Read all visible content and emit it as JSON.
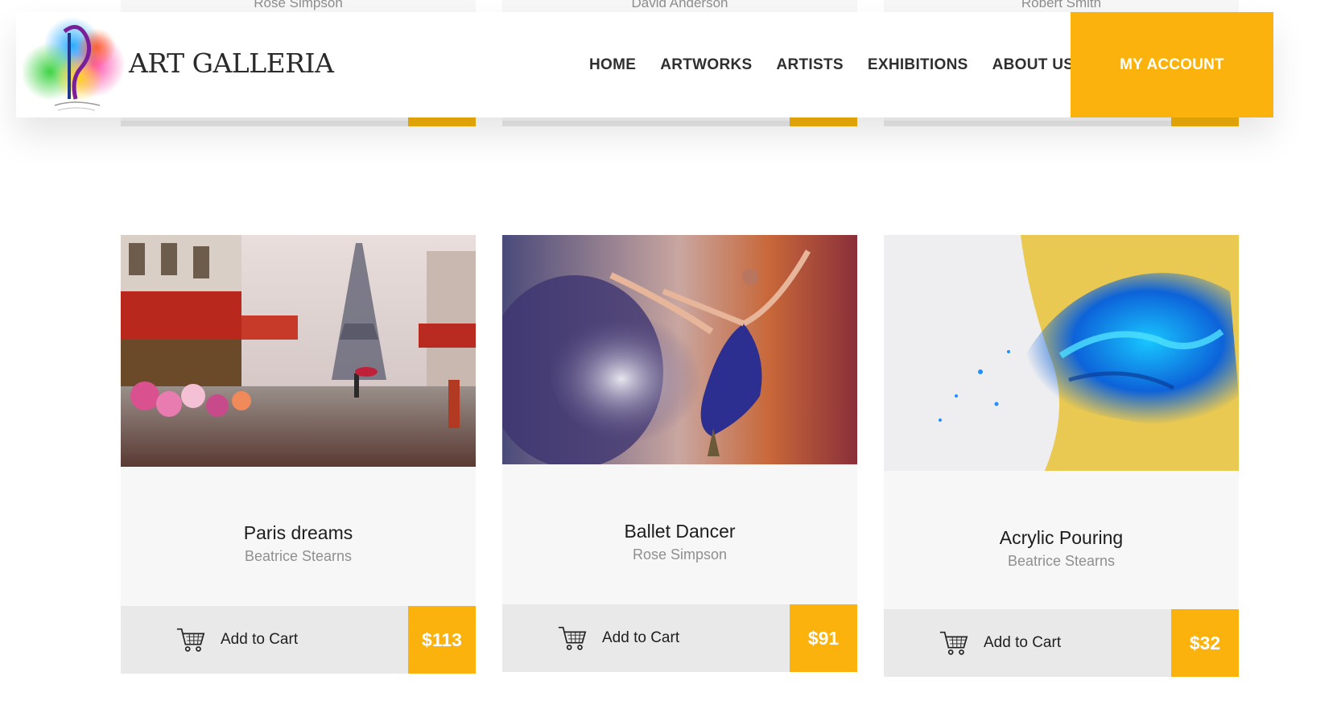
{
  "brand": {
    "name": "ART GALLERIA"
  },
  "nav": {
    "items": [
      "HOME",
      "ARTWORKS",
      "ARTISTS",
      "EXHIBITIONS",
      "ABOUT US"
    ],
    "account_label": "MY ACCOUNT"
  },
  "previous_row": {
    "artists": [
      "Rose Simpson",
      "David Anderson",
      "Robert Smith"
    ]
  },
  "products": [
    {
      "title": "Paris dreams",
      "artist": "Beatrice Stearns",
      "add_to_cart": "Add to Cart",
      "price": "$113"
    },
    {
      "title": "Ballet Dancer",
      "artist": "Rose Simpson",
      "add_to_cart": "Add to Cart",
      "price": "$91"
    },
    {
      "title": "Acrylic Pouring",
      "artist": "Beatrice Stearns",
      "add_to_cart": "Add to Cart",
      "price": "$32"
    }
  ],
  "colors": {
    "accent": "#fbb20c",
    "card_bg": "#f7f7f8",
    "cart_bar_bg": "#e9e9ea"
  },
  "icons": [
    "logo-mark",
    "cart-icon"
  ]
}
